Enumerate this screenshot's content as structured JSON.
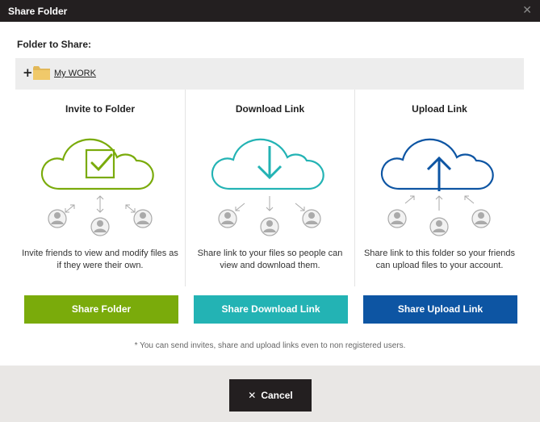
{
  "dialog": {
    "title": "Share Folder",
    "close_icon": "close-icon"
  },
  "folder": {
    "label": "Folder to Share:",
    "expand_symbol": "+",
    "icon": "folder-icon",
    "name": "My WORK"
  },
  "options": [
    {
      "heading": "Invite to Folder",
      "icon": "cloud-check-icon",
      "color": "#7aab0b",
      "description": "Invite friends to view and modify files as if they were their own.",
      "button_label": "Share Folder"
    },
    {
      "heading": "Download Link",
      "icon": "cloud-download-icon",
      "color": "#23b3b4",
      "description": "Share link to your files so people can view and download them.",
      "button_label": "Share Download Link"
    },
    {
      "heading": "Upload Link",
      "icon": "cloud-upload-icon",
      "color": "#0d55a3",
      "description": "Share link to this folder so your friends can upload files to your account.",
      "button_label": "Share Upload Link"
    }
  ],
  "note": "* You can send invites, share and upload links even to non registered users.",
  "footer": {
    "cancel_symbol": "✕",
    "cancel_label": "Cancel"
  }
}
